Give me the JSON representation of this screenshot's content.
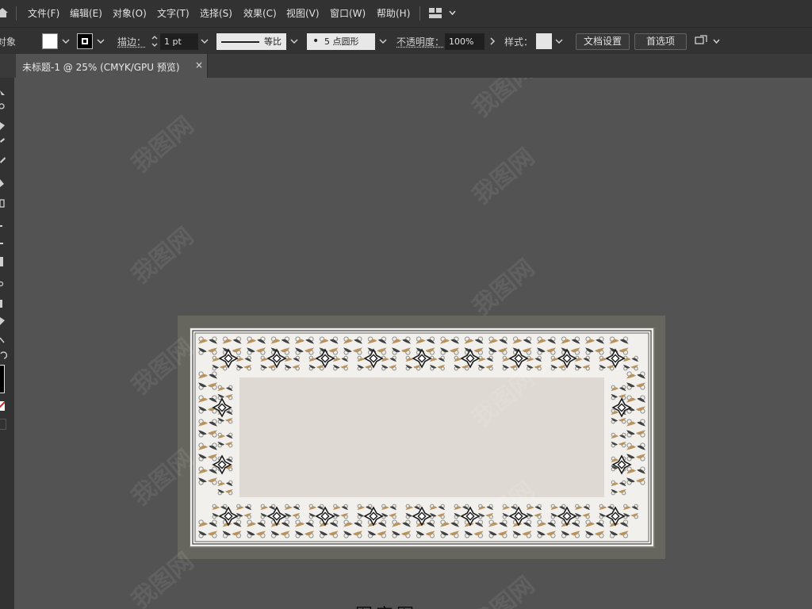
{
  "menu": {
    "items": [
      "文件(F)",
      "编辑(E)",
      "对象(O)",
      "文字(T)",
      "选择(S)",
      "效果(C)",
      "视图(V)",
      "窗口(W)",
      "帮助(H)"
    ]
  },
  "control": {
    "object_label": "对象",
    "stroke_label": "描边：",
    "stroke_value": "1 pt",
    "stroke_profile": "等比",
    "brush_label": "5 点圆形",
    "opacity_label": "不透明度：",
    "opacity_value": "100%",
    "style_label": "样式：",
    "doc_setup": "文档设置",
    "preferences": "首选项",
    "fill_color": "#ffffff",
    "stroke_color": "#000000"
  },
  "tab": {
    "title": "未标题-1 @ 25% (CMYK/GPU 预览)",
    "close": "×"
  },
  "artwork": {
    "colors": {
      "beige": "#b8935f",
      "dark": "#3f4143",
      "grey": "#9a9a96",
      "panel": "#dfd9d3",
      "bg": "#f2f0ec"
    }
  },
  "watermark": "我图网",
  "bottom_text": "图字图"
}
